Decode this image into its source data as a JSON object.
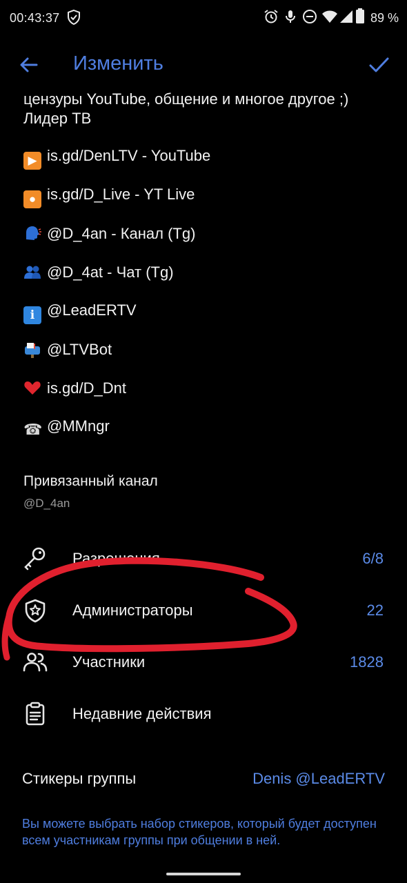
{
  "status": {
    "time": "00:43:37",
    "battery": "89 %"
  },
  "header": {
    "title": "Изменить"
  },
  "description": {
    "line1": "цензуры YouTube, общение и многое другое ;)",
    "line2": "Лидер ТВ",
    "links": [
      {
        "emoji": "play-emoji",
        "text": "is.gd/DenLTV - YouTube"
      },
      {
        "emoji": "record-emoji",
        "text": "is.gd/D_Live - YT Live"
      },
      {
        "emoji": "speaking-head-emoji",
        "text": "@D_4an - Канал (Tg)"
      },
      {
        "emoji": "people-emoji",
        "text": "@D_4at - Чат (Tg)"
      },
      {
        "emoji": "info-emoji",
        "text": "@LeadERTV"
      },
      {
        "emoji": "mailbox-emoji",
        "text": "@LTVBot"
      },
      {
        "emoji": "heart-emoji",
        "text": "is.gd/D_Dnt"
      },
      {
        "emoji": "telephone-emoji",
        "text": "@MMngr"
      }
    ]
  },
  "linked_channel": {
    "title": "Привязанный канал",
    "value": "@D_4an"
  },
  "menu": [
    {
      "icon": "key-icon",
      "label": "Разрешения",
      "value": "6/8"
    },
    {
      "icon": "shield-star-icon",
      "label": "Администраторы",
      "value": "22"
    },
    {
      "icon": "users-icon",
      "label": "Участники",
      "value": "1828"
    },
    {
      "icon": "clipboard-icon",
      "label": "Недавние действия",
      "value": ""
    }
  ],
  "stickers": {
    "label": "Стикеры группы",
    "value": "Denis @LeadERTV",
    "note": "Вы можете выбрать набор стикеров, который будет доступен всем участникам группы при общении в ней."
  },
  "colors": {
    "accent": "#4f7ee0",
    "background": "#000000",
    "highlight": "#e0202e"
  }
}
